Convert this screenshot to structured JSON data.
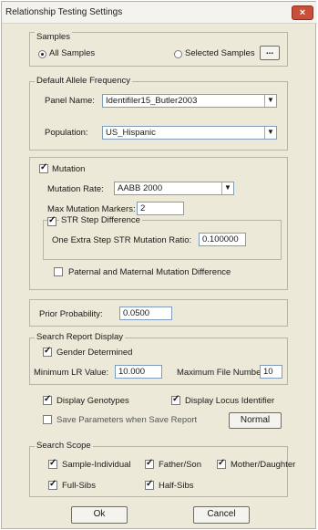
{
  "window": {
    "title": "Relationship Testing Settings",
    "close_glyph": "×"
  },
  "samples": {
    "legend": "Samples",
    "all_label": "All Samples",
    "selected_label": "Selected Samples",
    "browse_label": "..."
  },
  "allele": {
    "legend": "Default Allele Frequency",
    "panel_label": "Panel Name:",
    "panel_value": "Identifiler15_Butler2003",
    "population_label": "Population:",
    "population_value": "US_Hispanic"
  },
  "mutation": {
    "label": "Mutation",
    "rate_label": "Mutation Rate:",
    "rate_value": "AABB 2000",
    "max_label": "Max Mutation Markers:",
    "max_value": "2",
    "str_label": "STR Step Difference",
    "ratio_label": "One Extra Step STR Mutation Ratio:",
    "ratio_value": "0.100000",
    "paternal_label": "Paternal and Maternal Mutation Difference"
  },
  "prior": {
    "label": "Prior Probability:",
    "value": "0.0500"
  },
  "report": {
    "legend": "Search Report Display",
    "gender_label": "Gender Determined",
    "minlr_label": "Minimum LR Value:",
    "minlr_value": "10.000",
    "maxfile_label": "Maximum File Number:",
    "maxfile_value": "10"
  },
  "display": {
    "genotypes_label": "Display Genotypes",
    "locus_label": "Display Locus Identifier",
    "save_label": "Save Parameters when Save Report",
    "normal_label": "Normal"
  },
  "scope": {
    "legend": "Search Scope",
    "sample_individual": "Sample-Individual",
    "father_son": "Father/Son",
    "mother_daughter": "Mother/Daughter",
    "full_sibs": "Full-Sibs",
    "half_sibs": "Half-Sibs"
  },
  "buttons": {
    "ok": "Ok",
    "cancel": "Cancel"
  },
  "icons": {
    "dropdown": "▼",
    "check": "✓"
  }
}
